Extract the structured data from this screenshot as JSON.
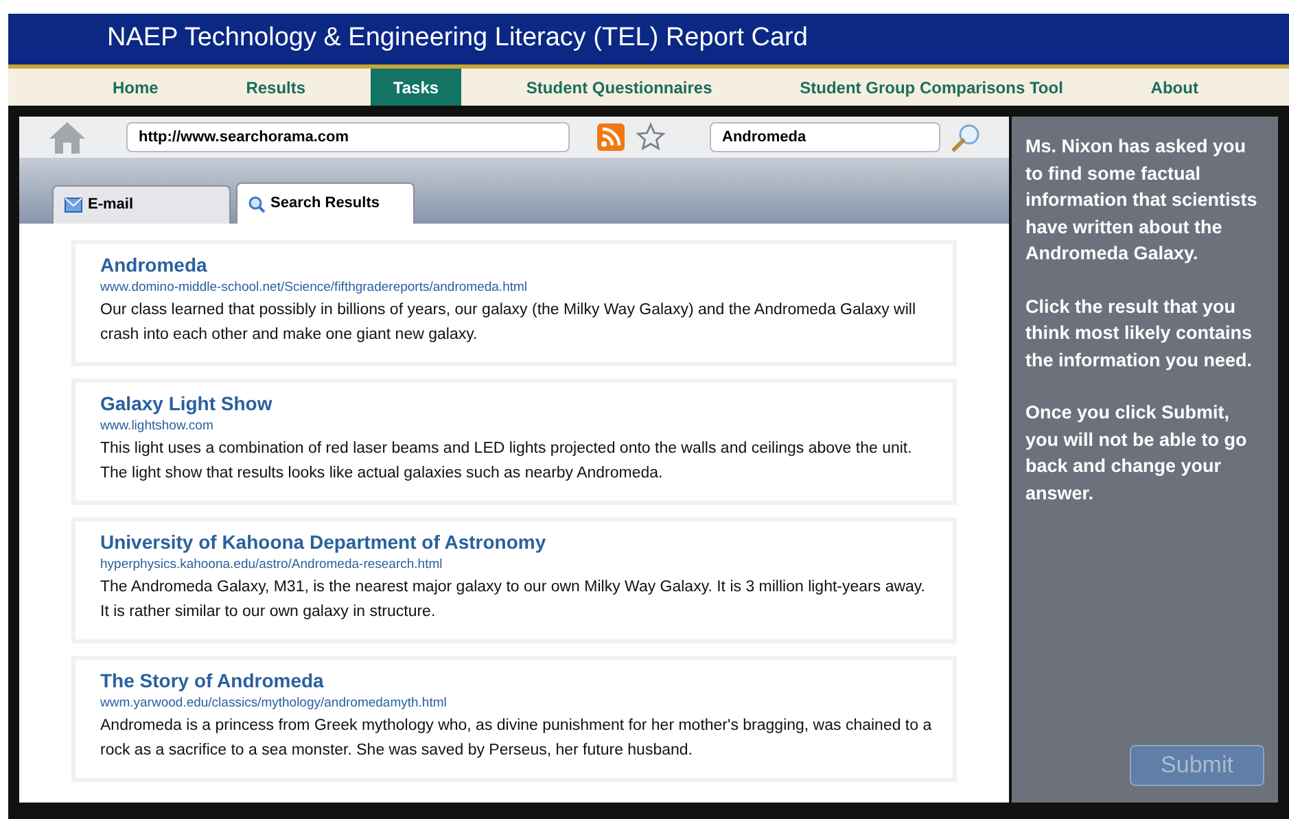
{
  "header": {
    "title": "NAEP Technology & Engineering Literacy (TEL) Report Card"
  },
  "nav": [
    {
      "label": "Home",
      "selected": false
    },
    {
      "label": "Results",
      "selected": false
    },
    {
      "label": "Tasks",
      "selected": true
    },
    {
      "label": "Student Questionnaires",
      "selected": false
    },
    {
      "label": "Student Group Comparisons Tool",
      "selected": false
    },
    {
      "label": "About",
      "selected": false
    }
  ],
  "browser": {
    "address": "http://www.searchorama.com",
    "search": "Andromeda"
  },
  "tabs": [
    {
      "label": "E-mail",
      "kind": "email",
      "selected": false
    },
    {
      "label": "Search Results",
      "kind": "search",
      "selected": true
    }
  ],
  "results": [
    {
      "title": "Andromeda",
      "url": "www.domino-middle-school.net/Science/fifthgradereports/andromeda.html",
      "snippet": "Our class learned that possibly in billions of years, our galaxy (the Milky Way Galaxy) and the Andromeda Galaxy will crash into each other and make one giant new galaxy."
    },
    {
      "title": "Galaxy Light Show",
      "url": "www.lightshow.com",
      "snippet": "This light uses a combination of red laser beams and LED lights projected onto the walls and ceilings above the unit. The light show that results looks like actual galaxies such as nearby Andromeda."
    },
    {
      "title": "University of Kahoona Department of Astronomy",
      "url": "hyperphysics.kahoona.edu/astro/Andromeda-research.html",
      "snippet": "The Andromeda Galaxy, M31, is the nearest major galaxy to our own Milky Way Galaxy. It is 3 million light-years away. It is rather similar to our own galaxy in structure."
    },
    {
      "title": "The Story of Andromeda",
      "url": "wwm.yarwood.edu/classics/mythology/andromedamyth.html",
      "snippet": "Andromeda is a princess from Greek mythology who, as divine punishment for her mother's bragging, was chained to a rock as a sacrifice to a sea monster. She was saved by Perseus, her future husband."
    }
  ],
  "instructions": [
    "Ms. Nixon has asked you to find some factual information that scientists have written about the Andromeda Galaxy.",
    "Click the result that you think most likely contains the information you need.",
    "Once you click Submit, you will not be able to go back and change your answer."
  ],
  "submit": {
    "label": "Submit",
    "disabled": true
  }
}
